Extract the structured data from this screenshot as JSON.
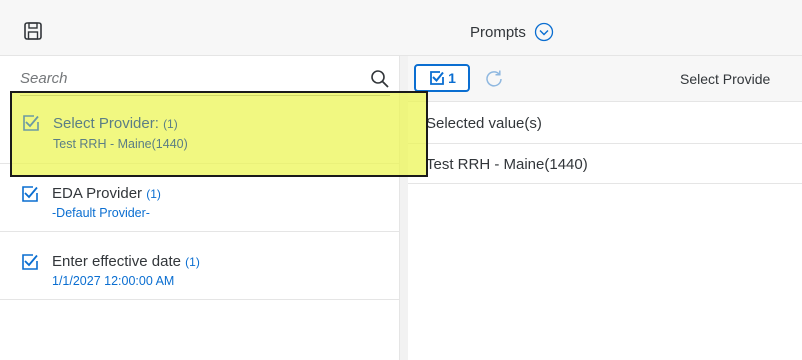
{
  "header": {
    "title": "Prompts",
    "save_icon": "save-icon",
    "chevron_icon": "chevron-down-circle-icon"
  },
  "search": {
    "placeholder": "Search",
    "icon": "search-icon"
  },
  "prompts": [
    {
      "title": "Select Provider:",
      "count": "(1)",
      "value": "Test RRH - Maine(1440)",
      "highlighted": true
    },
    {
      "title": "EDA Provider",
      "count": "(1)",
      "value": "-Default Provider-"
    },
    {
      "title": "Enter effective date",
      "count": "(1)",
      "value": "1/1/2027 12:00:00 AM"
    }
  ],
  "right_panel": {
    "selected_count": "1",
    "toolbar_title": "Select Provide",
    "column_header": "Selected value(s)",
    "rows": [
      {
        "value": "Test RRH - Maine(1440)"
      }
    ]
  },
  "colors": {
    "accent": "#0a6ed1",
    "highlight": "#ebf550",
    "text": "#32363a"
  }
}
